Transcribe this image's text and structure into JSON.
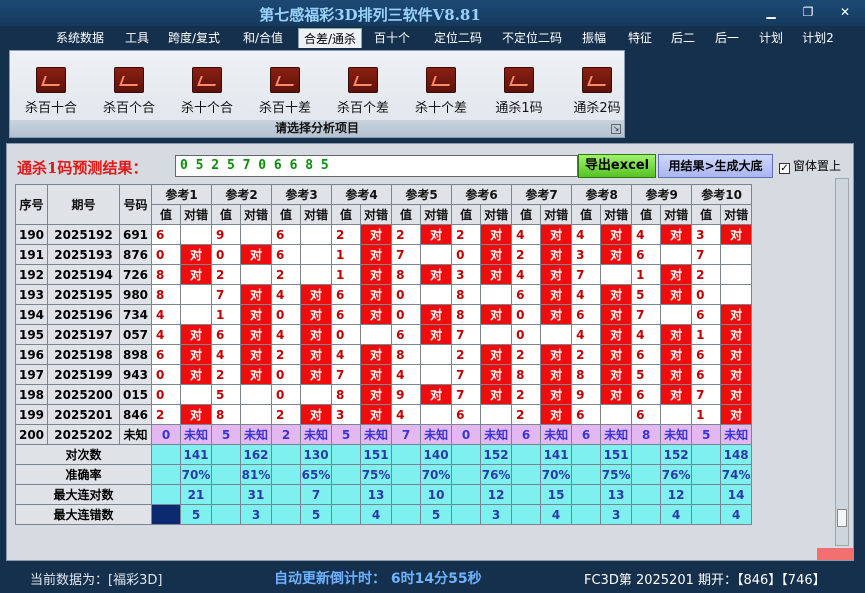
{
  "window": {
    "title": "第七感福彩3D排列三软件V8.81"
  },
  "menu": [
    "系统数据",
    "工具",
    "跨度/复式",
    "和/合值",
    "合差/通杀",
    "百十个",
    "定位二码",
    "不定位二码",
    "振幅",
    "特征",
    "后二",
    "后一",
    "计划",
    "计划2"
  ],
  "active_menu": "合差/通杀",
  "ribbon": {
    "items": [
      "杀百十合",
      "杀百个合",
      "杀十个合",
      "杀百十差",
      "杀百个差",
      "杀十个差",
      "通杀1码",
      "通杀2码"
    ],
    "caption": "请选择分析项目"
  },
  "result": {
    "label": "通杀1码预测结果：",
    "value": "0 5 2 5 7 0 6 6 8 5",
    "export_label": "导出excel",
    "generate_label": "用结果>生成大底",
    "ontop_label": "窗体置上",
    "ontop_checked": "✓"
  },
  "table": {
    "headers": {
      "seq": "序号",
      "period": "期号",
      "code": "号码",
      "val": "值",
      "check": "对错"
    },
    "refs": [
      "参考1",
      "参考2",
      "参考3",
      "参考4",
      "参考5",
      "参考6",
      "参考7",
      "参考8",
      "参考9",
      "参考10"
    ],
    "rows": [
      {
        "seq": "190",
        "period": "2025192",
        "code": "691",
        "vals": [
          "6",
          "9",
          "6",
          "2",
          "2",
          "2",
          "4",
          "4",
          "4",
          "3"
        ],
        "hits": [
          0,
          0,
          0,
          1,
          1,
          1,
          1,
          1,
          1,
          1
        ]
      },
      {
        "seq": "191",
        "period": "2025193",
        "code": "876",
        "vals": [
          "0",
          "0",
          "6",
          "1",
          "7",
          "0",
          "2",
          "3",
          "6",
          "7"
        ],
        "hits": [
          1,
          1,
          0,
          1,
          0,
          1,
          1,
          1,
          0,
          0
        ]
      },
      {
        "seq": "192",
        "period": "2025194",
        "code": "726",
        "vals": [
          "8",
          "2",
          "2",
          "1",
          "8",
          "3",
          "4",
          "7",
          "1",
          "2"
        ],
        "hits": [
          1,
          0,
          0,
          1,
          1,
          1,
          1,
          0,
          1,
          0
        ]
      },
      {
        "seq": "193",
        "period": "2025195",
        "code": "980",
        "vals": [
          "8",
          "7",
          "4",
          "6",
          "0",
          "8",
          "6",
          "4",
          "5",
          "0"
        ],
        "hits": [
          0,
          1,
          1,
          1,
          0,
          0,
          1,
          1,
          1,
          0
        ]
      },
      {
        "seq": "194",
        "period": "2025196",
        "code": "734",
        "vals": [
          "4",
          "1",
          "0",
          "6",
          "0",
          "8",
          "0",
          "6",
          "7",
          "6"
        ],
        "hits": [
          0,
          1,
          1,
          1,
          1,
          1,
          1,
          1,
          0,
          1
        ]
      },
      {
        "seq": "195",
        "period": "2025197",
        "code": "057",
        "vals": [
          "4",
          "6",
          "4",
          "0",
          "6",
          "7",
          "0",
          "4",
          "4",
          "1"
        ],
        "hits": [
          1,
          1,
          1,
          0,
          1,
          0,
          0,
          1,
          1,
          1
        ]
      },
      {
        "seq": "196",
        "period": "2025198",
        "code": "898",
        "vals": [
          "6",
          "4",
          "2",
          "4",
          "8",
          "2",
          "2",
          "2",
          "6",
          "6"
        ],
        "hits": [
          1,
          1,
          1,
          1,
          0,
          1,
          1,
          1,
          1,
          1
        ]
      },
      {
        "seq": "197",
        "period": "2025199",
        "code": "943",
        "vo": 1,
        "vals": [
          "0",
          "2",
          "0",
          "7",
          "4",
          "7",
          "8",
          "8",
          "5",
          "6"
        ],
        "hits": [
          1,
          1,
          1,
          1,
          0,
          1,
          1,
          1,
          1,
          1
        ]
      },
      {
        "seq": "198",
        "period": "2025200",
        "code": "015",
        "vals": [
          "0",
          "5",
          "0",
          "8",
          "9",
          "7",
          "2",
          "9",
          "6",
          "7"
        ],
        "hits": [
          0,
          0,
          0,
          1,
          1,
          1,
          1,
          1,
          1,
          1
        ]
      },
      {
        "seq": "199",
        "period": "2025201",
        "code": "846",
        "vals": [
          "2",
          "8",
          "2",
          "3",
          "4",
          "6",
          "2",
          "6",
          "6",
          "1"
        ],
        "hits": [
          1,
          0,
          1,
          1,
          0,
          0,
          1,
          0,
          0,
          1
        ]
      }
    ],
    "unknown_row": {
      "seq": "200",
      "period": "2025202",
      "code": "未知",
      "vals": [
        "0",
        "5",
        "2",
        "5",
        "7",
        "0",
        "6",
        "6",
        "8",
        "5"
      ],
      "status": "未知"
    },
    "hit_mark": "对",
    "stats": [
      {
        "label": "对次数",
        "values": [
          "141",
          "162",
          "130",
          "151",
          "140",
          "152",
          "141",
          "151",
          "152",
          "148"
        ]
      },
      {
        "label": "准确率",
        "values": [
          "70%",
          "81%",
          "65%",
          "75%",
          "70%",
          "76%",
          "70%",
          "75%",
          "76%",
          "74%"
        ]
      },
      {
        "label": "最大连对数",
        "values": [
          "21",
          "31",
          "7",
          "13",
          "10",
          "12",
          "15",
          "13",
          "12",
          "14"
        ]
      },
      {
        "label": "最大连错数",
        "values": [
          "5",
          "3",
          "5",
          "4",
          "5",
          "3",
          "4",
          "3",
          "4",
          "4"
        ]
      }
    ]
  },
  "status": {
    "left": "当前数据为：[福彩3D]",
    "countdown": "自动更新倒计时： 6时14分55秒",
    "right": "FC3D第 2025201 期开：【846】【746】"
  }
}
